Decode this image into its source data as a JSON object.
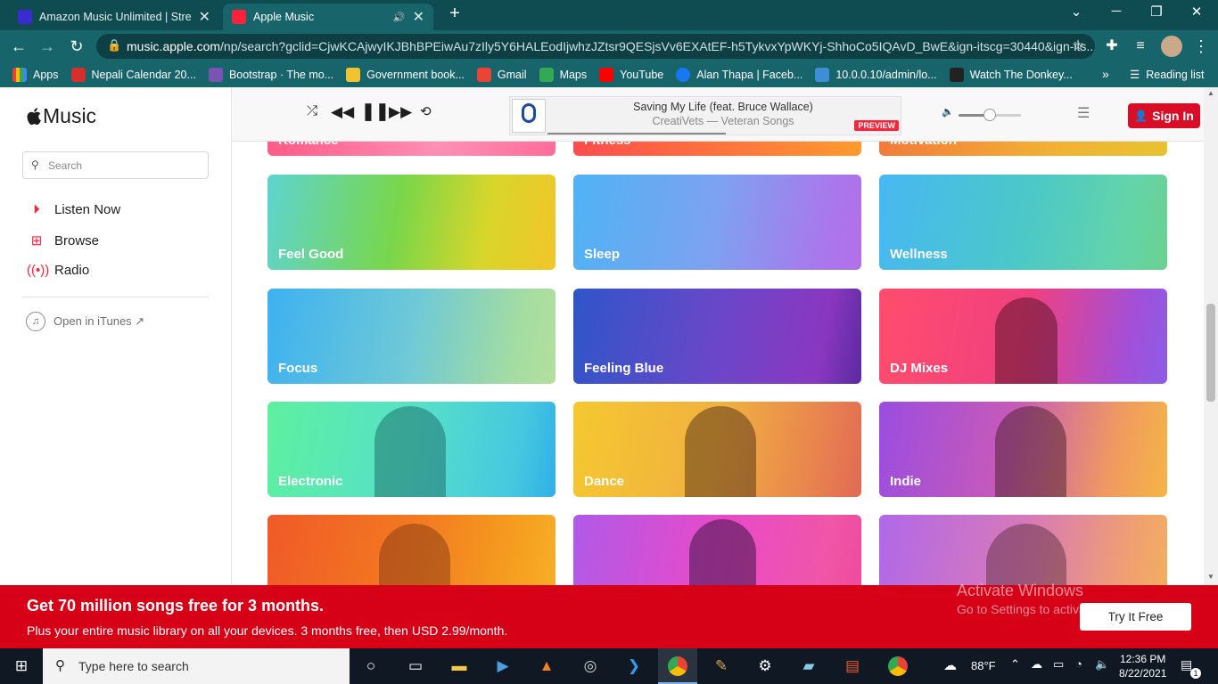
{
  "browser": {
    "tabs": [
      {
        "title": "Amazon Music Unlimited | Stream",
        "active": false
      },
      {
        "title": "Apple Music",
        "active": true
      }
    ],
    "url_host": "music.apple.com",
    "url_path": "/np/search?gclid=CjwKCAjwyIKJBhBPEiwAu7zIly5Y6HALEodIjwhzJZtsr9QESjsVv6EXAtEF-h5TykvxYpWKYj-ShhoCo5IQAvD_BwE&ign-itscg=30440&ign-its...",
    "bookmarks": [
      "Apps",
      "Nepali Calendar 20...",
      "Bootstrap · The mo...",
      "Government book...",
      "Gmail",
      "Maps",
      "YouTube",
      "Alan Thapa | Faceb...",
      "10.0.0.10/admin/lo...",
      "Watch The Donkey..."
    ],
    "reading_list": "Reading list"
  },
  "app": {
    "logo_text": "Music",
    "search_placeholder": "Search",
    "nav": [
      {
        "label": "Listen Now",
        "icon": "play-circle-icon"
      },
      {
        "label": "Browse",
        "icon": "grid-icon"
      },
      {
        "label": "Radio",
        "icon": "radio-waves-icon"
      }
    ],
    "open_itunes": "Open in iTunes ↗"
  },
  "player": {
    "track_title": "Saving My Life (feat. Bruce Wallace)",
    "track_subtitle": "CreatiVets —  Veteran Songs",
    "preview_badge": "PREVIEW",
    "volume_level": 0.5,
    "sign_in": "Sign In"
  },
  "tiles": {
    "partial_top": [
      "Romance",
      "Fitness",
      "Motivation"
    ],
    "rows": [
      [
        "Feel Good",
        "Sleep",
        "Wellness"
      ],
      [
        "Focus",
        "Feeling Blue",
        "DJ Mixes"
      ],
      [
        "Electronic",
        "Dance",
        "Indie"
      ]
    ]
  },
  "promo": {
    "headline": "Get 70 million songs free for 3 months.",
    "subline": "Plus your entire music library on all your devices. 3 months free, then USD 2.99/month.",
    "cta": "Try It Free"
  },
  "watermark": {
    "line1": "Activate Windows",
    "line2": "Go to Settings to activate Windows."
  },
  "taskbar": {
    "search_placeholder": "Type here to search",
    "weather": "88°F",
    "time": "12:36 PM",
    "date": "8/22/2021",
    "notification_count": "1"
  }
}
